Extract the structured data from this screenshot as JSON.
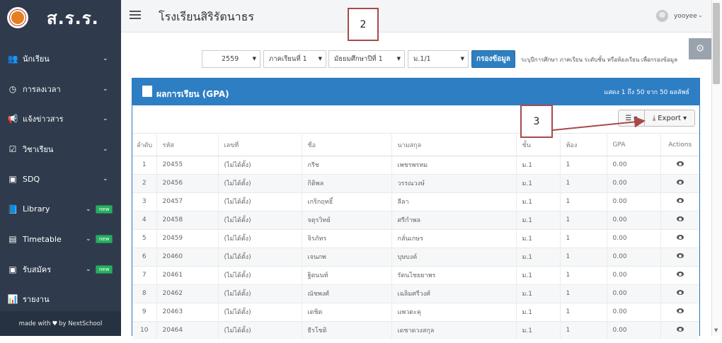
{
  "brand": {
    "name": "ส.ร.ร."
  },
  "sidebar": {
    "items": [
      {
        "label": "นักเรียน",
        "icon": "students-icon",
        "chevron": true,
        "badge": ""
      },
      {
        "label": "การลงเวลา",
        "icon": "clock-icon",
        "chevron": true,
        "badge": ""
      },
      {
        "label": "แจ้งข่าวสาร",
        "icon": "megaphone-icon",
        "chevron": true,
        "badge": ""
      },
      {
        "label": "วิชาเรียน",
        "icon": "calendar-check-icon",
        "chevron": true,
        "badge": ""
      },
      {
        "label": "SDQ",
        "icon": "sdq-icon",
        "chevron": true,
        "badge": ""
      },
      {
        "label": "Library",
        "icon": "book-icon",
        "chevron": true,
        "badge": "new"
      },
      {
        "label": "Timetable",
        "icon": "timetable-icon",
        "chevron": true,
        "badge": "new"
      },
      {
        "label": "รับสมัคร",
        "icon": "id-card-icon",
        "chevron": true,
        "badge": "new"
      },
      {
        "label": "รายงาน",
        "icon": "bar-chart-icon",
        "chevron": false,
        "badge": ""
      }
    ],
    "footer_prefix": "made with",
    "footer_suffix": "by NextSchool"
  },
  "header": {
    "title": "โรงเรียนสิริรัตนาธร",
    "user": "yooyee",
    "user_caret": "⌄"
  },
  "filters": {
    "year": "2559",
    "term": "ภาคเรียนที่ 1",
    "level": "มัธยมศึกษาปีที่ 1",
    "room": "ม.1/1",
    "submit_label": "กรองข้อมูล",
    "hint": "ระบุปีการศึกษา ภาคเรียน ระดับชั้น หรือห้องเรียน เพื่อกรองข้อมูล"
  },
  "panel": {
    "title": "ผลการเรียน (GPA)",
    "count_text": "แสดง 1 ถึง 50 จาก 50 ผลลัพธ์",
    "columns_button": "☰ ▾",
    "export_label": "Export ▾"
  },
  "table": {
    "headers": [
      "ลำดับ",
      "รหัส",
      "เลขที่",
      "ชื่อ",
      "นามสกุล",
      "ชั้น",
      "ห้อง",
      "GPA",
      "Actions"
    ],
    "rows": [
      [
        "1",
        "20455",
        "(ไม่ได้ตั้ง)",
        "กรีช",
        "เพชรพรหม",
        "ม.1",
        "1",
        "0.00"
      ],
      [
        "2",
        "20456",
        "(ไม่ได้ตั้ง)",
        "กิติพล",
        "วรรณวงษ์",
        "ม.1",
        "1",
        "0.00"
      ],
      [
        "3",
        "20457",
        "(ไม่ได้ตั้ง)",
        "เกริกฤทธิ์",
        "ลีลา",
        "ม.1",
        "1",
        "0.00"
      ],
      [
        "4",
        "20458",
        "(ไม่ได้ตั้ง)",
        "จตุรวิทย์",
        "ศรีกำพล",
        "ม.1",
        "1",
        "0.00"
      ],
      [
        "5",
        "20459",
        "(ไม่ได้ตั้ง)",
        "จิรภัทร",
        "กลั่นเกษร",
        "ม.1",
        "1",
        "0.00"
      ],
      [
        "6",
        "20460",
        "(ไม่ได้ตั้ง)",
        "เจนภพ",
        "บุษบงค์",
        "ม.1",
        "1",
        "0.00"
      ],
      [
        "7",
        "20461",
        "(ไม่ได้ตั้ง)",
        "ฐิตนนท์",
        "รัตนไชยยาพร",
        "ม.1",
        "1",
        "0.00"
      ],
      [
        "8",
        "20462",
        "(ไม่ได้ตั้ง)",
        "ณัชพงศ์",
        "เฉลิมศรีวงศ์",
        "ม.1",
        "1",
        "0.00"
      ],
      [
        "9",
        "20463",
        "(ไม่ได้ตั้ง)",
        "เตชิต",
        "แพวตะคุ",
        "ม.1",
        "1",
        "0.00"
      ],
      [
        "10",
        "20464",
        "(ไม่ได้ตั้ง)",
        "ธีรโชติ",
        "เดชาดวงสกุล",
        "ม.1",
        "1",
        "0.00"
      ]
    ]
  },
  "annotations": {
    "a2": "2",
    "a3": "3"
  },
  "colors": {
    "sidebar": "#2f3b4c",
    "accent": "#2e7ec4",
    "badge": "#27ae60",
    "annotation": "#a94a4a"
  }
}
